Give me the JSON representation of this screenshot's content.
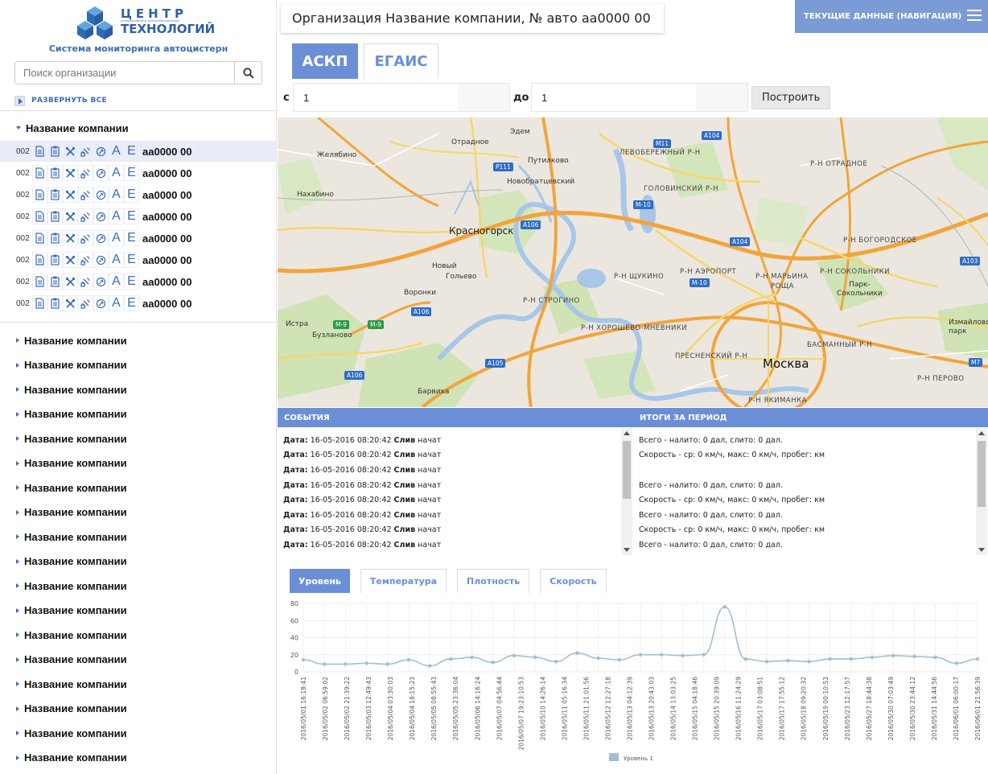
{
  "sidebar": {
    "logo_title": "ЦЕНТР",
    "logo_subtitle_small": "ИНФОРМАЦИОННО-КОММУНИКАЦИОННЫХ",
    "logo_title2": "ТЕХНОЛОГИЙ",
    "system_subtitle": "Система мониторинга автоцистерн",
    "search_placeholder": "Поиск организации",
    "expand_all": "РАЗВЕРНУТЬ ВСЕ",
    "expanded_company": "Название компании",
    "vehicles": [
      {
        "num": "002",
        "plate": "аа0000 00"
      },
      {
        "num": "002",
        "plate": "аа0000 00"
      },
      {
        "num": "002",
        "plate": "аа0000 00"
      },
      {
        "num": "002",
        "plate": "аа0000 00"
      },
      {
        "num": "002",
        "plate": "аа0000 00"
      },
      {
        "num": "002",
        "plate": "аа0000 00"
      },
      {
        "num": "002",
        "plate": "аа0000 00"
      },
      {
        "num": "002",
        "plate": "аа0000 00"
      }
    ],
    "vehicle_letters": [
      "А",
      "Е"
    ],
    "companies": [
      "Название компании",
      "Название компании",
      "Название компании",
      "Название компании",
      "Название компании",
      "Название компании",
      "Название компании",
      "Название компании",
      "Название компании",
      "Название компании",
      "Название компании",
      "Название компании",
      "Название компании",
      "Название компании",
      "Название компании",
      "Название компании",
      "Название компании",
      "Название компании"
    ]
  },
  "header": {
    "org_title": "Организация Название компании, № авто аа0000 00",
    "nav_button": "ТЕКУЩИЕ ДАННЫЕ (НАВИГАЦИЯ)"
  },
  "tabs": [
    "АСКП",
    "ЕГАИС"
  ],
  "range": {
    "from_label": "с",
    "from_value": "1",
    "to_label": "до",
    "to_value": "1",
    "build_button": "Построить"
  },
  "map": {
    "labels": {
      "edem": "Эдем",
      "otradnoe1": "Отрадное",
      "zhelyabino": "Желябино",
      "putilkovo": "Путилково",
      "novobratsevsky": "Новобратцевский",
      "nakhabino": "Нахабино",
      "krasnogorsk": "Красногорск",
      "noviy": "Новый",
      "golyevo": "Гольево",
      "voronki": "Воронки",
      "istra": "Истра",
      "buzlanovo": "Бузланово",
      "barvikha": "Барвиха",
      "moskva": "Москва",
      "park": "Парк-\nСокольники",
      "izmaylovsky": "Измайловский\nпарк"
    },
    "districts": {
      "levoberezhny": "ЛЕВОБЕРЕЖНЫЙ Р-Н",
      "otradnoe": "Р-Н ОТРАДНОЕ",
      "golovinsky": "ГОЛОВИНСКИЙ Р-Н",
      "bogorodskoe": "Р-Н БОГОРОДСКОЕ",
      "aeroport": "Р-Н АЭРОПОРТ",
      "maryina": "Р-Н МАРЬИНА",
      "roshcha": "РОЩА",
      "sokolniki": "Р-Н СОКОЛЬНИКИ",
      "shchukino": "Р-Н ЩУКИНО",
      "strogino": "Р-Н СТРОГИНО",
      "khoroshevo": "Р-Н ХОРОШЕВО-МНЕВНИКИ",
      "presnensky": "ПРЕСНЕНСКИЙ Р-Н",
      "basmanny": "БАСМАННЫЙ Р-Н",
      "perovo": "Р-Н ПЕРОВО",
      "yakimanka": "Р-Н ЯКИМАНКА"
    },
    "shields": {
      "m11": "M11",
      "a104a": "A104",
      "p111": "P111",
      "m10a": "M-10",
      "a106a": "A106",
      "a104b": "A104",
      "a103": "A103",
      "m10b": "M-10",
      "a106b": "A106",
      "m9a": "M-9",
      "m9b": "M-9",
      "a105": "A105",
      "a106c": "A106",
      "m7": "M7"
    }
  },
  "events": {
    "title": "СОБЫТИЯ",
    "date_label": "Дата:",
    "rows": [
      {
        "date": "16-05-2016 08:20:42",
        "event": "Слив",
        "status": "начат"
      },
      {
        "date": "16-05-2016 08:20:42",
        "event": "Слив",
        "status": "начат"
      },
      {
        "date": "16-05-2016 08:20:42",
        "event": "Слив",
        "status": "начат"
      },
      {
        "date": "16-05-2016 08:20:42",
        "event": "Слив",
        "status": "начат"
      },
      {
        "date": "16-05-2016 08:20:42",
        "event": "Слив",
        "status": "начат"
      },
      {
        "date": "16-05-2016 08:20:42",
        "event": "Слив",
        "status": "начат"
      },
      {
        "date": "16-05-2016 08:20:42",
        "event": "Слив",
        "status": "начат"
      },
      {
        "date": "16-05-2016 08:20:42",
        "event": "Слив",
        "status": "начат"
      },
      {
        "date": "16-05-2016 08:20:42",
        "event": "Слив",
        "status": "начат"
      }
    ]
  },
  "totals": {
    "title": "ИТОГИ ЗА ПЕРИОД",
    "rows": [
      "Всего - налито: 0 дал, слито: 0 дал.",
      "Скорость - ср: 0 км/ч, макс: 0 км/ч, пробег: км",
      "",
      "Всего - налито: 0 дал, слито: 0 дал.",
      "Скорость - ср: 0 км/ч, макс: 0 км/ч, пробег: км",
      "Всего - налито: 0 дал, слито: 0 дал.",
      "Скорость - ср: 0 км/ч, макс: 0 км/ч, пробег: км",
      "Всего - налито: 0 дал, слито: 0 дал.",
      "Скорость - ср: 0 км/ч, макс: 0 км/ч, пробег: км"
    ]
  },
  "chart_tabs": [
    "Уровень",
    "Температура",
    "Плотность",
    "Скорость"
  ],
  "chart_data": {
    "type": "line",
    "series": [
      {
        "name": "Уровень 1",
        "color": "#9fbfd3",
        "values": [
          14,
          9,
          9,
          10,
          9,
          14,
          7,
          15,
          17,
          11,
          19,
          17,
          12,
          22,
          16,
          14,
          20,
          20,
          19,
          20,
          76,
          15,
          12,
          13,
          12,
          15,
          15,
          17,
          19,
          18,
          17,
          10,
          15
        ]
      }
    ],
    "x": [
      "2016/05/01 16:18:41",
      "2016/05/02 06:59:02",
      "2016/05/02 21:39:22",
      "2016/05/03 12:49:43",
      "2016/05/04 03:00:03",
      "2016/05/04 18:15:23",
      "2016/05/05 08:55:43",
      "2016/05/05 23:36:04",
      "2016/05/06 14:16:24",
      "2016/05/07 04:56:44",
      "2016/05/07 19:37:04",
      "2016/05/08 10:17:24",
      "2016/05/09 00:57:44",
      "2016/05/09 15:38:03",
      "2016/05/10 06:18:22",
      "2016/05/10 20:58:41",
      "2016/05/11 11:39:00",
      "2016/05/12 02:19:19",
      "2016/05/12 16:59:38",
      "2016/05/13 07:39:58",
      "2016/05/13 22:20:18",
      "2016/05/14 13:00:38",
      "2016/05/15 03:40:58",
      "2016/05/15 18:21:18",
      "2016/05/16 09:01:38",
      "2016/05/16 23:41:58",
      "2016/05/17 14:22:18",
      "2016/05/18 05:02:38",
      "2016/05/18 19:42:58",
      "2016/05/19 10:23:18",
      "2016/05/20 01:03:38",
      "2016/05/20 15:43:58",
      "2016/05/21 06:24:18"
    ],
    "x_tick_labels": [
      "2016/05/01 16:18:41",
      "2016/05/02 06:59:02",
      "2016/05/02 21:39:22",
      "2016/05/03 12:49:43",
      "2016/05/04 03:30:03",
      "2016/05/04 18:15:23",
      "2016/05/05 08:55:43",
      "2016/05/05 23:36:04",
      "2016/05/06 14:16:24",
      "2016/05/07 04:56:44",
      "2016/05/07 19:23:10:53",
      "2016/05/10 14:26:14",
      "2016/05/11 05:16:34",
      "2016/05/11 21:01:56",
      "2016/05/12 12:27:18",
      "2016/05/13 04:12:39",
      "2016/05/13 20:43:03",
      "2016/05/14 13:03:25",
      "2016/05/15 04:18:46",
      "2016/05/15 20:39:09",
      "2016/05/16 11:24:29",
      "2016/05/17 03:08:51",
      "2016/05/17 17:55:12",
      "2016/05/18 09:20:32",
      "2016/05/19 00:10:53",
      "2016/05/23 12:17:57",
      "2016/05/27 18:44:38",
      "2016/05/30 07:03:49",
      "2016/05/30 23:44:12",
      "2016/05/31 14:44:56",
      "2016/06/01 06:00:17",
      "2016/06/01 21:56:39"
    ],
    "ylim": [
      0,
      80
    ],
    "yticks": [
      0,
      20,
      40,
      60,
      80
    ],
    "grid": true,
    "legend": "bottom"
  }
}
